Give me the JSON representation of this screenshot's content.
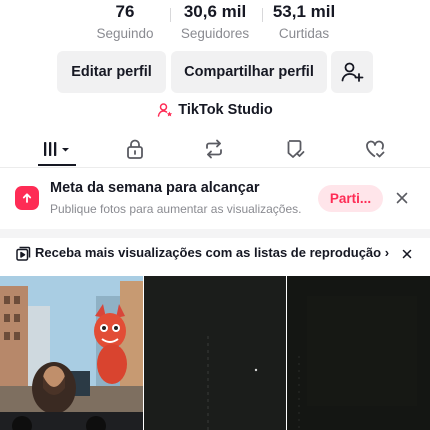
{
  "stats": {
    "following": {
      "value": "76",
      "label": "Seguindo"
    },
    "followers": {
      "value": "30,6 mil",
      "label": "Seguidores"
    },
    "likes": {
      "value": "53,1 mil",
      "label": "Curtidas"
    }
  },
  "actions": {
    "edit_profile": "Editar perfil",
    "share_profile": "Compartilhar perfil"
  },
  "studio": {
    "label": "TikTok Studio"
  },
  "tabs": [
    {
      "icon": "grid-icon",
      "active": true
    },
    {
      "icon": "lock-icon",
      "active": false
    },
    {
      "icon": "repost-icon",
      "active": false
    },
    {
      "icon": "bookmark-icon",
      "active": false
    },
    {
      "icon": "liked-heart-icon",
      "active": false
    }
  ],
  "goal": {
    "title": "Meta da semana para alcançar",
    "subtitle": "Publique fotos para aumentar as visualizações.",
    "button": "Parti..."
  },
  "playlist": {
    "text": "Receba mais visualizações com as listas de reprodução"
  },
  "colors": {
    "accent": "#fe2c55",
    "text": "#161823",
    "muted": "#8a8b91",
    "button_bg": "#f1f1f2"
  }
}
